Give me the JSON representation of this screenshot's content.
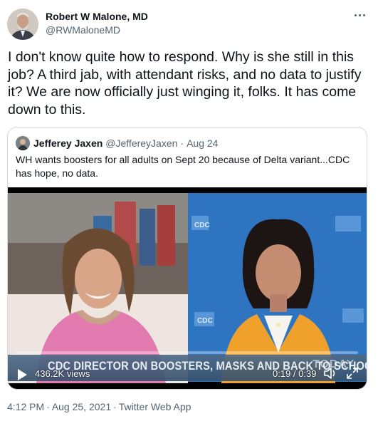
{
  "author": {
    "display_name": "Robert W Malone, MD",
    "handle": "@RWMaloneMD",
    "avatar_icon": "profile-photo"
  },
  "tweet": {
    "text": "I don't know quite how to respond.  Why is she still in this job?  A third jab, with attendant risks, and no data to justify it?  We are now officially just winging it, folks.  It has come down to this."
  },
  "quoted_tweet": {
    "display_name": "Jefferey Jaxen",
    "handle": "@JeffereyJaxen",
    "separator": "·",
    "date": "Aug 24",
    "text": "WH wants boosters for all adults on Sept 20 because of Delta variant...CDC has hope, no data.",
    "video": {
      "chyron": "CDC DIRECTOR ON BOOSTERS, MASKS AND BACK TO SCHOOL",
      "watermark": "TODAY",
      "backdrop_label": "CDC",
      "views": "436.2K views",
      "time": "0:19 / 0:39",
      "progress": 0.0,
      "colors": {
        "chyron": "#3f5a76",
        "backdrop": "#2f74c0",
        "jacket": "#f0a12c",
        "dress": "#e27ab0"
      }
    }
  },
  "footer": {
    "time": "4:12 PM",
    "separator": "·",
    "date": "Aug 25, 2021",
    "source": "Twitter Web App"
  }
}
